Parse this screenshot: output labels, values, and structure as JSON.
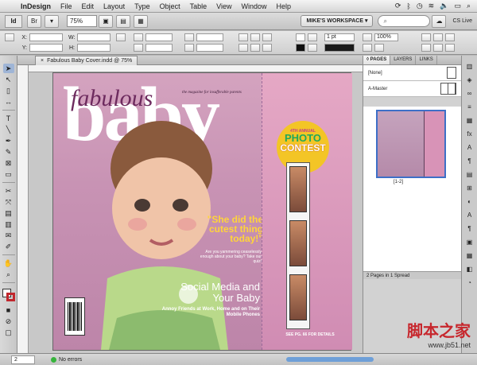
{
  "menubar": {
    "items": [
      "InDesign",
      "File",
      "Edit",
      "Layout",
      "Type",
      "Object",
      "Table",
      "View",
      "Window",
      "Help"
    ]
  },
  "appbar": {
    "logo": "Id",
    "zoom": "75%",
    "workspace": "MIKE'S WORKSPACE ▾",
    "search_placeholder": "",
    "cs_live": "CS Live"
  },
  "controlbar": {
    "x_label": "X:",
    "y_label": "Y:",
    "w_label": "W:",
    "h_label": "H:",
    "stroke_weight": "1 pt",
    "stroke_percent": "100%"
  },
  "document": {
    "tab_title": "Fabulous Baby Cover.indd @ 75%",
    "close_glyph": "×"
  },
  "cover": {
    "masthead_script": "fabulous",
    "masthead": "baby",
    "tagline": "the magazine for insufferable parents",
    "headline": "\"She did the cutest thing today!\"",
    "subhead": "Are you yammering ceaselessly enough about your baby? Take our quiz!",
    "social": "Social Media and Your Baby",
    "annoy": "Annoy Friends at Work, Home and on Their Mobile Phones",
    "contest_top": "4TH ANNUAL",
    "contest_photo": "PHOTO",
    "contest_word": "CONTEST",
    "see_page": "SEE PG. 66 FOR DETAILS"
  },
  "pages_panel": {
    "tabs": [
      "◊ PAGES",
      "LAYERS",
      "LINKS"
    ],
    "none_label": "[None]",
    "master_label": "A-Master",
    "spread_label": "[1-2]",
    "footer": "2 Pages in 1 Spread"
  },
  "status": {
    "page": "2",
    "errors": "No errors"
  },
  "watermark": {
    "cn": "脚本之家",
    "url": "www.jb51.net"
  }
}
